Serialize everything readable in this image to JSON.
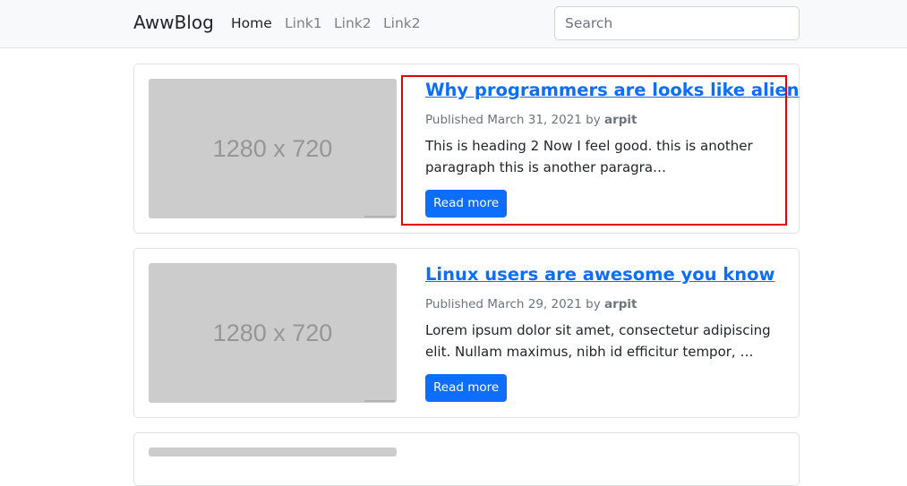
{
  "nav": {
    "brand": "AwwBlog",
    "links": [
      {
        "label": "Home"
      },
      {
        "label": "Link1"
      },
      {
        "label": "Link2"
      },
      {
        "label": "Link2"
      }
    ],
    "search_placeholder": "Search"
  },
  "posts": [
    {
      "title": "Why programmers are looks like alien",
      "published_prefix": "Published March 31, 2021 by",
      "author": "arpit",
      "excerpt": "This is heading 2 Now I feel good. this is another paragraph this is another paragra…",
      "button": "Read more",
      "thumb_label": "1280 x 720"
    },
    {
      "title": "Linux users are awesome you know",
      "published_prefix": "Published March 29, 2021 by",
      "author": "arpit",
      "excerpt": "Lorem ipsum dolor sit amet, consectetur adipiscing elit. Nullam maximus, nibh id efficitur tempor, …",
      "button": "Read more",
      "thumb_label": "1280 x 720"
    }
  ],
  "colors": {
    "primary": "#0d6efd",
    "highlight": "#e00000",
    "navbar_bg": "#f8f9fa",
    "placeholder_bg": "#cccccc"
  }
}
